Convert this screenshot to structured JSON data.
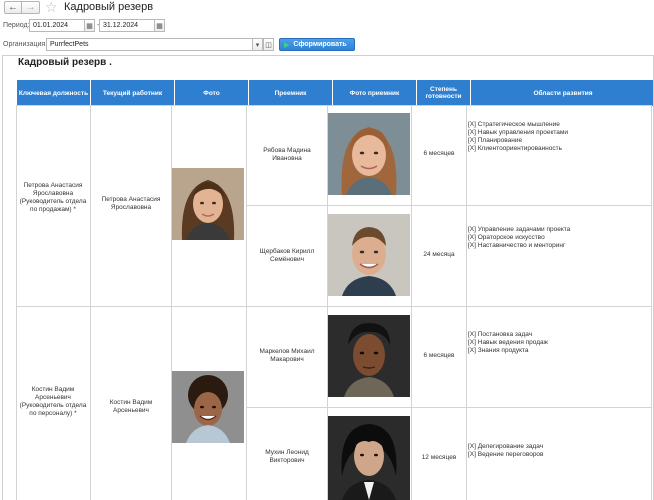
{
  "window": {
    "title": "Кадровый резерв"
  },
  "filters": {
    "period_label": "Период:",
    "date_from": "01.01.2024",
    "date_to": "31.12.2024",
    "org_label": "Организация:",
    "org_value": "PurrfectPets",
    "generate_label": "Сформировать"
  },
  "report": {
    "title": "Кадровый резерв .",
    "columns": [
      "Ключевая должность",
      "Текущий работник",
      "Фото",
      "Преемник",
      "Фото приемник",
      "Степень готовности",
      "Области развития"
    ],
    "groups": [
      {
        "key_position": "Петрова Анастасия Ярославовна (Руководитель отдела по продажам) *",
        "current_employee": "Петрова Анастасия Ярославовна",
        "successors": [
          {
            "name": "Рябова Мадина Ивановна",
            "readiness": "6 месяцев",
            "areas": [
              "[X] Стратегическое мышление",
              "[X] Навык управления проектами",
              "[X] Планирование",
              "[X] Клиентоориентированность"
            ]
          },
          {
            "name": "Щербаков Кирилл Семёнович",
            "readiness": "24 месяца",
            "areas": [
              "[X] Управление задачами проекта",
              "[X] Ораторское искусство",
              "[X] Наставничество и менторинг"
            ]
          }
        ]
      },
      {
        "key_position": "Костин Вадим Арсеньевич (Руководитель отдела по персоналу) *",
        "current_employee": "Костин Вадим Арсеньевич",
        "successors": [
          {
            "name": "Маркелов Михаил Макарович",
            "readiness": "6 месяцев",
            "areas": [
              "[X] Постановка задач",
              "[X] Навык ведения продаж",
              "[X] Знания продукта"
            ]
          },
          {
            "name": "Мухин Леонид Викторович",
            "readiness": "12 месяцев",
            "areas": [
              "[X] Делегирование задач",
              "[X] Ведение переговоров"
            ]
          }
        ]
      }
    ]
  }
}
